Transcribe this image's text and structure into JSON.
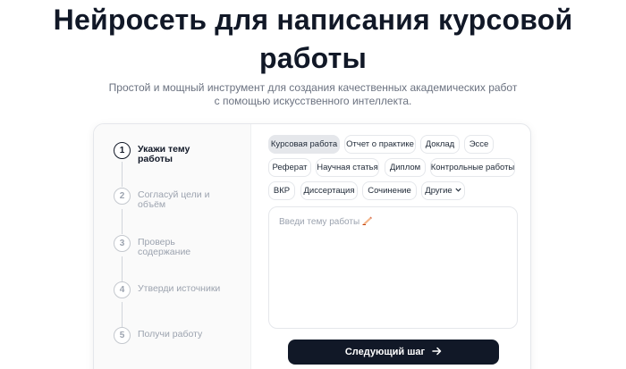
{
  "hero": {
    "title_line1": "Нейросеть для написания курсовой",
    "title_line2": "работы",
    "subtitle": "Простой и мощный инструмент для создания качественных академических работ с помощью искусственного интеллекта."
  },
  "steps": [
    {
      "number": "1",
      "label": "Укажи тему работы",
      "active": true
    },
    {
      "number": "2",
      "label": "Согласуй цели и объём",
      "active": false
    },
    {
      "number": "3",
      "label": "Проверь содержание",
      "active": false
    },
    {
      "number": "4",
      "label": "Утверди источники",
      "active": false
    },
    {
      "number": "5",
      "label": "Получи работу",
      "active": false
    }
  ],
  "work_types": [
    {
      "label": "Курсовая работа",
      "selected": true
    },
    {
      "label": "Отчет о практике",
      "selected": false
    },
    {
      "label": "Доклад",
      "selected": false
    },
    {
      "label": "Эссе",
      "selected": false
    },
    {
      "label": "Реферат",
      "selected": false
    },
    {
      "label": "Научная статья",
      "selected": false
    },
    {
      "label": "Диплом",
      "selected": false
    },
    {
      "label": "Контрольные работы",
      "selected": false
    },
    {
      "label": "ВКР",
      "selected": false
    },
    {
      "label": "Диссертация",
      "selected": false
    },
    {
      "label": "Сочинение",
      "selected": false
    },
    {
      "label": "Другие",
      "selected": false,
      "icon": "chevron-down-icon"
    }
  ],
  "topic_input": {
    "placeholder": "Введи тему работы",
    "icon": "writing-hand-icon"
  },
  "next_button": {
    "label": "Следующий шаг",
    "icon": "arrow-right-icon"
  },
  "colors": {
    "primary": "#111827",
    "muted_text": "#9ca3af",
    "chip_selected_bg": "#e5e7eb",
    "border": "#e5e7eb"
  }
}
